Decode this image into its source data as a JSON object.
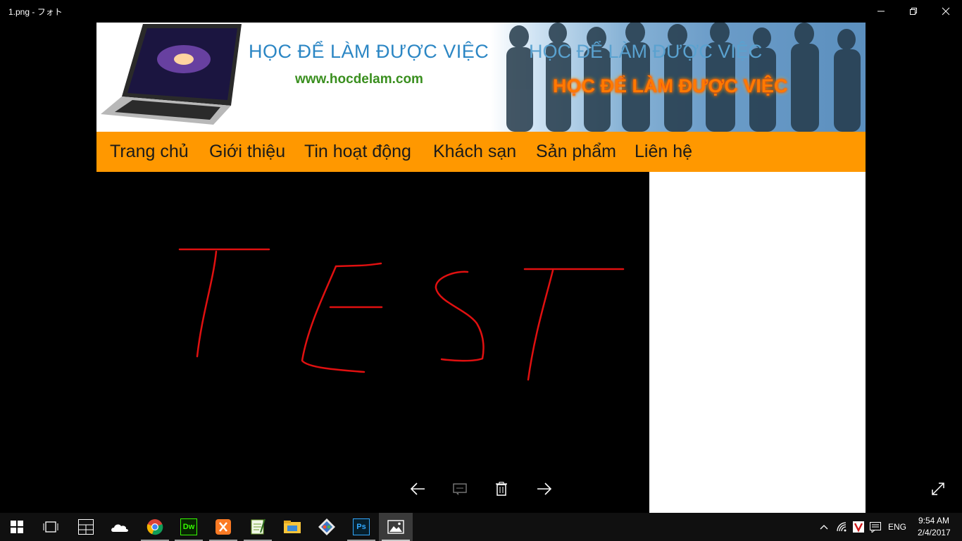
{
  "window": {
    "title": "1.png - フォト"
  },
  "banner": {
    "headline": "HỌC ĐỂ LÀM ĐƯỢC VIỆC",
    "url": "www.hocdelam.com",
    "headline_right": "HỌC ĐỂ LÀM ĐƯỢC VIỆC",
    "headline_fire": "HỌC ĐỂ LÀM ĐƯỢC VIỆC"
  },
  "nav": {
    "items": [
      {
        "label": "Trang chủ"
      },
      {
        "label": "Giới thiệu"
      },
      {
        "label": "Tin hoạt động"
      },
      {
        "label": "Khách sạn"
      },
      {
        "label": "Sản phẩm"
      },
      {
        "label": "Liên hệ"
      }
    ]
  },
  "colors": {
    "nav_bg": "#ff9800",
    "stroke": "#e01010"
  },
  "viewer_controls": [
    "back-arrow-icon",
    "slideshow-icon",
    "delete-icon",
    "forward-arrow-icon",
    "fullscreen-icon"
  ],
  "taskbar": {
    "apps": [
      "windows-start-icon",
      "task-view-icon",
      "calculator-icon",
      "onedrive-icon",
      "chrome-icon",
      "dreamweaver-icon",
      "xampp-icon",
      "notepad-icon",
      "file-explorer-icon",
      "sourcetree-icon",
      "photoshop-icon",
      "photos-icon"
    ],
    "dw_label": "Dw",
    "ps_label": "Ps",
    "language": "ENG",
    "time": "9:54 AM",
    "date": "2/4/2017"
  }
}
